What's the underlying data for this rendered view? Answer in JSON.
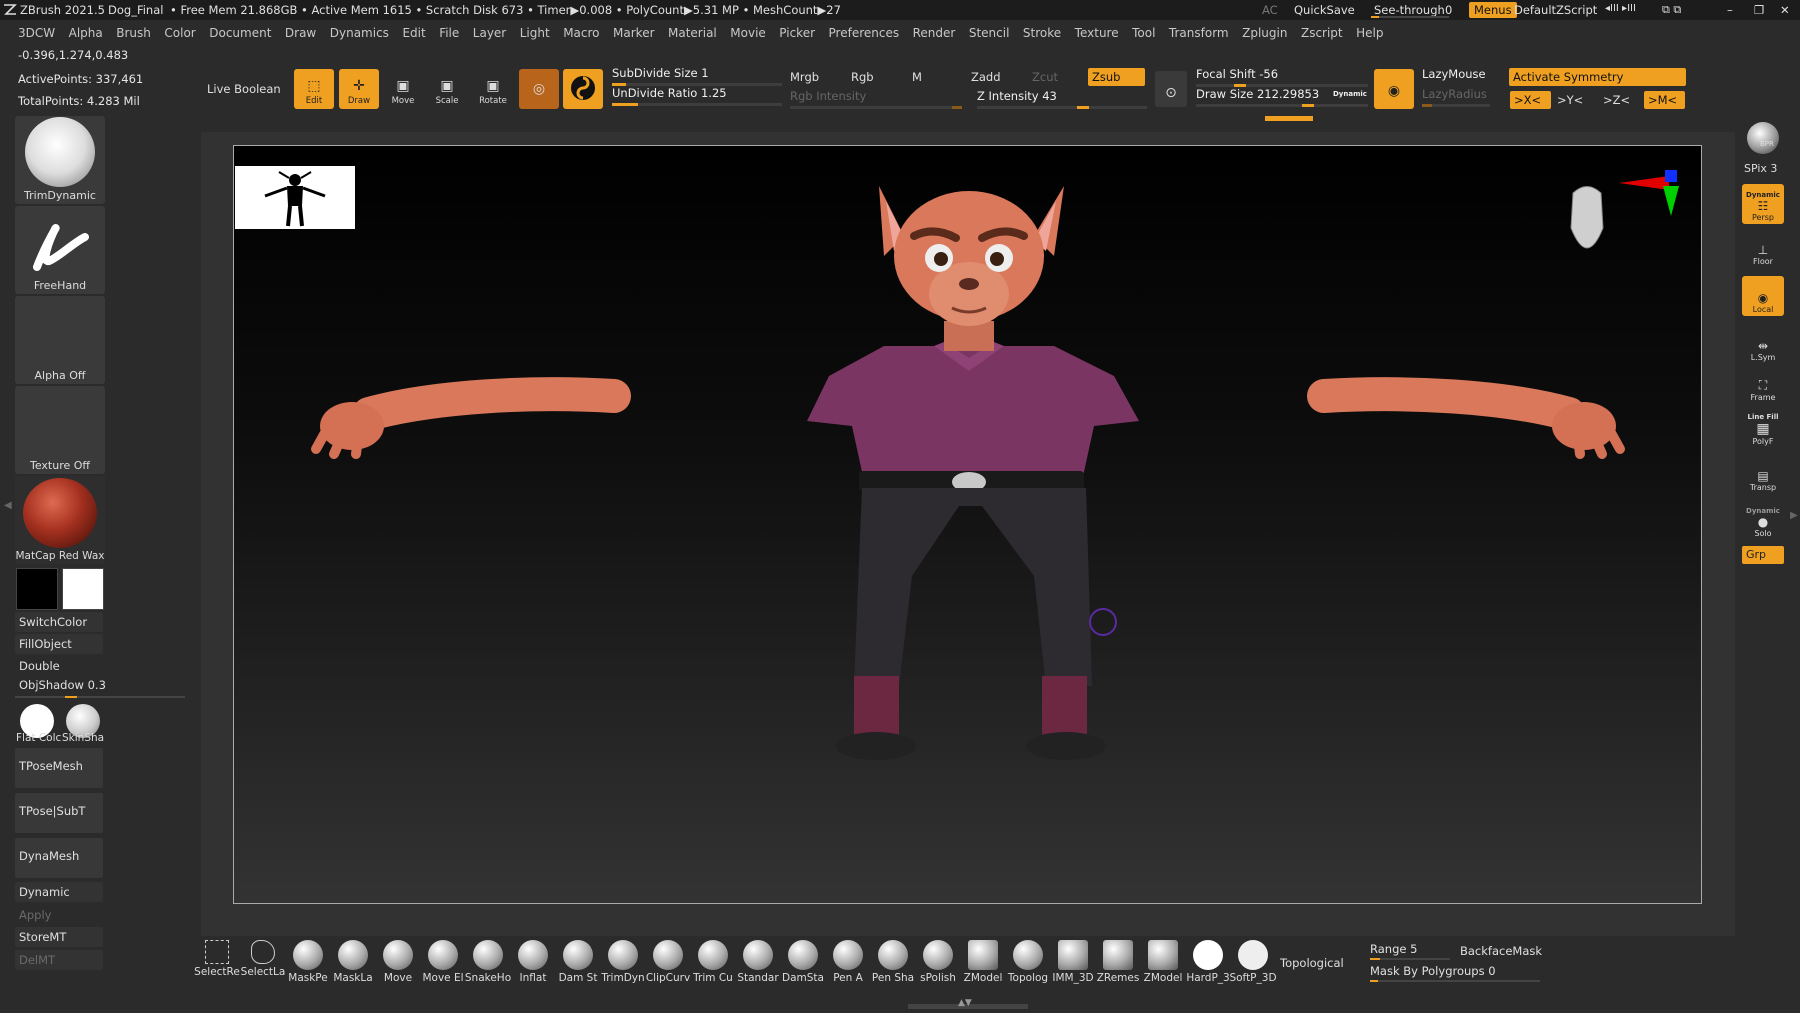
{
  "titlebar": {
    "app": "ZBrush 2021.5",
    "doc": "Dog_Final",
    "stats": "• Free Mem 21.868GB • Active Mem 1615 • Scratch Disk 673 • Timer▶0.008 • PolyCount▶5.31 MP • MeshCount▶27",
    "ac": "AC",
    "quicksave": "QuickSave",
    "seethrough": "See-through",
    "seethrough_value": "0",
    "menus": "Menus",
    "script": "DefaultZScript"
  },
  "menubar": [
    "3DCW",
    "Alpha",
    "Brush",
    "Color",
    "Document",
    "Draw",
    "Dynamics",
    "Edit",
    "File",
    "Layer",
    "Light",
    "Macro",
    "Marker",
    "Material",
    "Movie",
    "Picker",
    "Preferences",
    "Render",
    "Stencil",
    "Stroke",
    "Texture",
    "Tool",
    "Transform",
    "Zplugin",
    "Zscript",
    "Help"
  ],
  "info": {
    "coords": "-0.396,1.274,0.483",
    "active_points": "ActivePoints: 337,461",
    "total_points": "TotalPoints: 4.283 Mil"
  },
  "toolbar": {
    "live_boolean": "Live Boolean",
    "edit": "Edit",
    "draw": "Draw",
    "move": "Move",
    "scale": "Scale",
    "rotate": "Rotate",
    "subdivide_size": "SubDivide Size 1",
    "undivide_ratio": "UnDivide Ratio 1.25",
    "mrgb": "Mrgb",
    "rgb": "Rgb",
    "m": "M",
    "rgb_intensity": "Rgb Intensity",
    "zadd": "Zadd",
    "zcut": "Zcut",
    "zsub": "Zsub",
    "z_intensity": "Z Intensity 43",
    "focal_shift": "Focal Shift -56",
    "draw_size": "Draw Size 212.29853",
    "dynamic": "Dynamic",
    "lazymouse": "LazyMouse",
    "lazyradius": "LazyRadius",
    "activate_symmetry": "Activate Symmetry",
    "sym_x": ">X<",
    "sym_y": ">Y<",
    "sym_z": ">Z<",
    "sym_m": ">M<",
    "subdivide_fill": 0.08,
    "undivide_fill": 0.15,
    "z_intensity_fill": 0.43,
    "focal_fill": 0.22,
    "drawsize_fill": 0.75
  },
  "left_shelf": {
    "brush1": "TrimDynamic",
    "brush2": "FreeHand",
    "alpha": "Alpha Off",
    "texture": "Texture Off",
    "material": "MatCap Red Wax",
    "switchcolor": "SwitchColor",
    "fillobject": "FillObject",
    "double": "Double",
    "objshadow": "ObjShadow",
    "objshadow_value": "0.3",
    "flat_color": "Flat Colc",
    "skin_shade": "SkinSha",
    "tposemesh": "TPoseMesh",
    "tpose_subt": "TPose|SubT",
    "dynamesh": "DynaMesh",
    "dynamic": "Dynamic",
    "apply": "Apply",
    "storemt": "StoreMT",
    "delmt": "DelMT"
  },
  "right_shelf": {
    "bpr": "BPR",
    "spix": "SPix 3",
    "persp": "Persp",
    "dynamic": "Dynamic",
    "floor": "Floor",
    "local": "Local",
    "lsym": "L.Sym",
    "frame": "Frame",
    "line_fill": "Line Fill",
    "polyf": "PolyF",
    "transp": "Transp",
    "dynamic2": "Dynamic",
    "solo": "Solo",
    "grp": "Grp"
  },
  "bottom_shelf": {
    "brushes": [
      "SelectRe",
      "SelectLa",
      "MaskPe",
      "MaskLa",
      "Move",
      "Move El",
      "SnakeHo",
      "Inflat",
      "Dam St",
      "TrimDyn",
      "ClipCurv",
      "Trim Cu",
      "Standar",
      "DamSta",
      "Pen A",
      "Pen Sha",
      "sPolish",
      "ZModel",
      "Topolog",
      "IMM_3D",
      "ZRemes",
      "ZModel",
      "HardP_3",
      "SoftP_3D"
    ],
    "topological": "Topological",
    "range": "Range 5",
    "backfacemask": "BackfaceMask",
    "mask_by_polygroups": "Mask By Polygroups 0"
  },
  "colors": {
    "accent": "#f0a020",
    "shirt": "#7a3562",
    "skin": "#d9785a",
    "pants": "#2e2b30",
    "boots": "#6b2840"
  }
}
